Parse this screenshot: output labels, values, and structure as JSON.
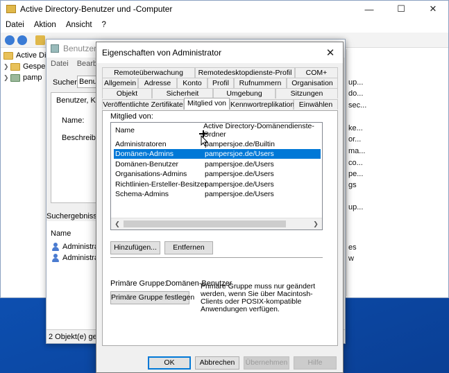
{
  "main_window": {
    "title": "Active Directory-Benutzer und -Computer",
    "menu": [
      "Datei",
      "Aktion",
      "Ansicht",
      "?"
    ],
    "tree": [
      {
        "label": "Active Dir"
      },
      {
        "label": "Gespe"
      },
      {
        "label": "pamp"
      }
    ],
    "right_pane_lines": [
      "up...",
      "do...",
      "sec...",
      "ke...",
      "or...",
      "ma...",
      "co...",
      "pe...",
      "gs",
      "up..."
    ],
    "right_pane_lines2": [
      "es",
      "w"
    ]
  },
  "search_window": {
    "title": "Benutzer, ...",
    "menu": [
      "Datei",
      "Bearbe"
    ],
    "search_label": "Suchen:",
    "search_value": "Benutz",
    "tab_label": "Benutzer, Kon",
    "name_label": "Name:",
    "desc_label": "Beschreibun",
    "results_label": "Suchergebnisse:",
    "list_header": "Name",
    "rows": [
      "Administra",
      "Administra"
    ],
    "status": "2 Objekt(e) gefu"
  },
  "dialog": {
    "title": "Eigenschaften von Administrator",
    "tabs_row1": [
      "Remoteüberwachung",
      "Remotedesktopdienste-Profil",
      "COM+"
    ],
    "tabs_row2": [
      "Allgemein",
      "Adresse",
      "Konto",
      "Profil",
      "Rufnummern",
      "Organisation"
    ],
    "tabs_row3": [
      "Objekt",
      "Sicherheit",
      "Umgebung",
      "Sitzungen"
    ],
    "tabs_row4": [
      "Veröffentlichte Zertifikate",
      "Mitglied von",
      "Kennwortreplikation",
      "Einwählen"
    ],
    "member_of_label": "Mitglied von:",
    "columns": {
      "name": "Name",
      "folder": "Active Directory-Domänendienste-Ordner"
    },
    "rows": [
      {
        "name": "Administratoren",
        "folder": "pampersjoe.de/Builtin",
        "selected": false
      },
      {
        "name": "Domänen-Admins",
        "folder": "pampersjoe.de/Users",
        "selected": true
      },
      {
        "name": "Domänen-Benutzer",
        "folder": "pampersjoe.de/Users",
        "selected": false
      },
      {
        "name": "Organisations-Admins",
        "folder": "pampersjoe.de/Users",
        "selected": false
      },
      {
        "name": "Richtlinien-Ersteller-Besitzer",
        "folder": "pampersjoe.de/Users",
        "selected": false
      },
      {
        "name": "Schema-Admins",
        "folder": "pampersjoe.de/Users",
        "selected": false
      }
    ],
    "add_button": "Hinzufügen...",
    "remove_button": "Entfernen",
    "primary_group_label": "Primäre Gruppe:",
    "primary_group_value": "Domänen-Benutzer",
    "set_primary_button": "Primäre Gruppe festlegen",
    "note": "Primäre Gruppe muss nur geändert werden, wenn Sie über Macintosh-Clients oder POSIX-kompatible Anwendungen verfügen.",
    "ok_button": "OK",
    "cancel_button": "Abbrechen",
    "apply_button": "Übernehmen",
    "help_button": "Hilfe"
  },
  "colors": {
    "selection": "#0078d7",
    "desktop": "#0d4fb0",
    "folder": "#e8c15a"
  }
}
